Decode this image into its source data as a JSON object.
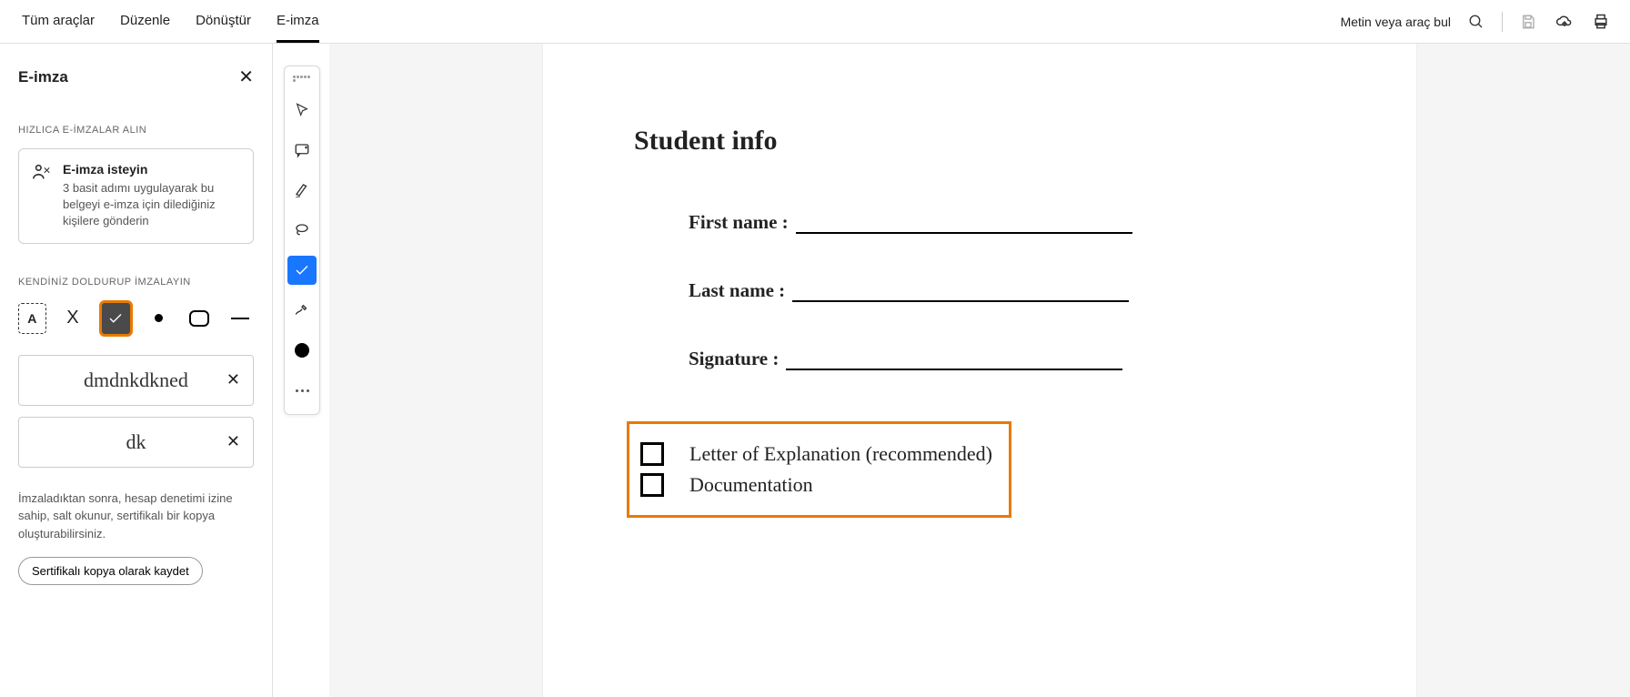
{
  "topbar": {
    "tabs": [
      "Tüm araçlar",
      "Düzenle",
      "Dönüştür",
      "E-imza"
    ],
    "active_tab_index": 3,
    "search_label": "Metin veya araç bul"
  },
  "panel": {
    "title": "E-imza",
    "section1_label": "HIZLICA E-İMZALAR ALIN",
    "request": {
      "title": "E-imza isteyin",
      "desc": "3 basit adımı uygulayarak bu belgeyi e-imza için dilediğiniz kişilere gönderin"
    },
    "section2_label": "KENDİNİZ DOLDURUP İMZALAYIN",
    "signatures": [
      "dmdnkdkned",
      "dk"
    ],
    "footer_text": "İmzaladıktan sonra, hesap denetimi izine sahip, salt okunur, sertifikalı bir kopya oluşturabilirsiniz.",
    "cert_button": "Sertifikalı kopya olarak kaydet"
  },
  "doc": {
    "title": "Student info",
    "fields": [
      "First name :",
      "Last name :",
      "Signature :"
    ],
    "checks": [
      "Letter of Explanation (recommended)",
      "Documentation"
    ]
  }
}
